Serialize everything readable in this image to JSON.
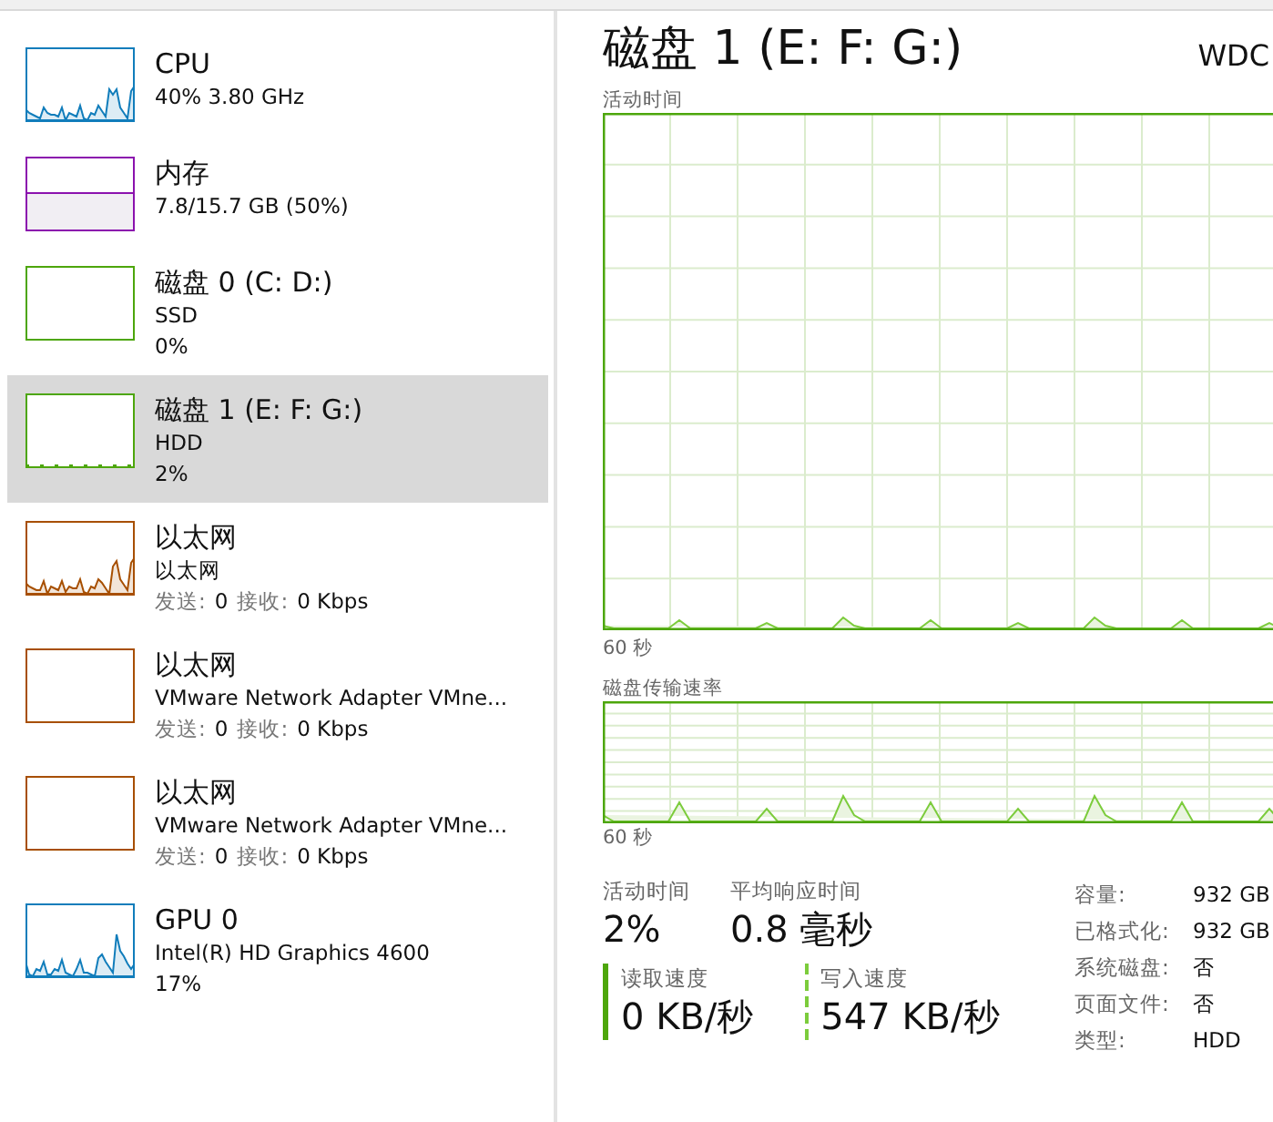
{
  "devices": [
    {
      "kind": "line",
      "title": "CPU",
      "lines": [
        "40% 3.80 GHz"
      ],
      "color": "#117dbb",
      "selected": false
    },
    {
      "kind": "memory",
      "title": "内存",
      "lines": [
        "7.8/15.7 GB (50%)"
      ],
      "color": "#8b12ae",
      "selected": false
    },
    {
      "kind": "empty",
      "title": "磁盘 0 (C: D:)",
      "lines": [
        "SSD",
        "0%"
      ],
      "color": "#4da60c",
      "selected": false
    },
    {
      "kind": "flat",
      "title": "磁盘 1 (E: F: G:)",
      "lines": [
        "HDD",
        "2%"
      ],
      "color": "#4da60c",
      "selected": true
    },
    {
      "kind": "line",
      "title": "以太网",
      "lines": [
        "以太网"
      ],
      "stats": [
        {
          "label": "发送:",
          "value": "0"
        },
        {
          "label": "接收:",
          "value": "0 Kbps"
        }
      ],
      "color": "#a74f01",
      "selected": false
    },
    {
      "kind": "empty",
      "title": "以太网",
      "lines": [
        "VMware Network Adapter VMne..."
      ],
      "stats": [
        {
          "label": "发送:",
          "value": "0"
        },
        {
          "label": "接收:",
          "value": "0 Kbps"
        }
      ],
      "color": "#a74f01",
      "selected": false
    },
    {
      "kind": "empty",
      "title": "以太网",
      "lines": [
        "VMware Network Adapter VMne..."
      ],
      "stats": [
        {
          "label": "发送:",
          "value": "0"
        },
        {
          "label": "接收:",
          "value": "0 Kbps"
        }
      ],
      "color": "#a74f01",
      "selected": false
    },
    {
      "kind": "line",
      "title": "GPU 0",
      "lines": [
        "Intel(R) HD Graphics 4600",
        "17%"
      ],
      "color": "#117dbb",
      "selected": false
    }
  ],
  "detail": {
    "title": "磁盘 1 (E: F: G:)",
    "model": "WDC",
    "activity_chart": {
      "label": "活动时间",
      "time_label": "60 秒"
    },
    "transfer_chart": {
      "label": "磁盘传输速率",
      "time_label": "60 秒"
    },
    "stats": [
      {
        "label": "活动时间",
        "value": "2%"
      },
      {
        "label": "平均响应时间",
        "value": "0.8 毫秒"
      }
    ],
    "speeds": [
      {
        "kind": "read",
        "label": "读取速度",
        "value": "0 KB/秒"
      },
      {
        "kind": "write",
        "label": "写入速度",
        "value": "547 KB/秒"
      }
    ],
    "properties": [
      {
        "label": "容量:",
        "value": "932 GB"
      },
      {
        "label": "已格式化:",
        "value": "932 GB"
      },
      {
        "label": "系统磁盘:",
        "value": "否"
      },
      {
        "label": "页面文件:",
        "value": "否"
      },
      {
        "label": "类型:",
        "value": "HDD"
      }
    ]
  }
}
